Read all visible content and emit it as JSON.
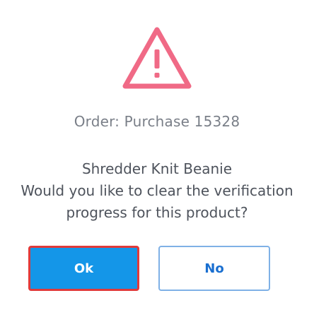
{
  "dialog": {
    "icon": "warning-triangle-icon",
    "order_line": "Order: Purchase 15328",
    "product_name": "Shredder Knit Beanie",
    "question_line1": "Would you like to clear the verification",
    "question_line2": "progress for this product?",
    "ok_label": "Ok",
    "no_label": "No"
  },
  "colors": {
    "warning": "#f06a86",
    "ok_background": "#1496e8",
    "ok_border_highlight": "#e13a3a",
    "no_border": "#7fb1e6",
    "no_text": "#1a6fd0"
  }
}
